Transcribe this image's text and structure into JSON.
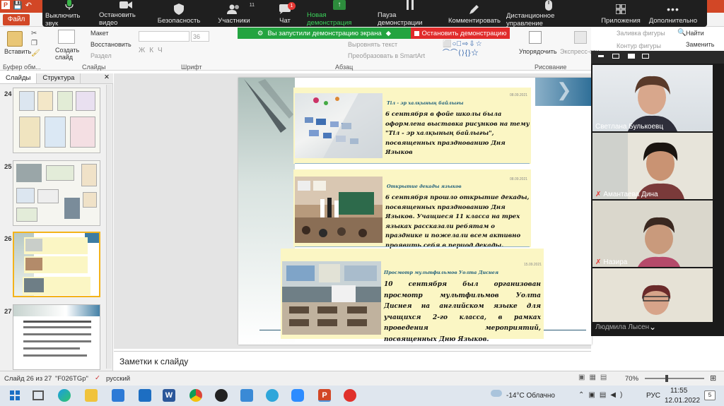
{
  "window": {
    "file_tab": "Файл"
  },
  "zoom_toolbar": {
    "items": [
      {
        "label": "Выключить звук",
        "icon": "microphone-icon"
      },
      {
        "label": "Остановить видео",
        "icon": "camera-icon"
      },
      {
        "label": "Безопасность",
        "icon": "shield-icon"
      },
      {
        "label": "Участники",
        "icon": "participants-icon",
        "count": "11"
      },
      {
        "label": "Чат",
        "icon": "chat-icon",
        "badge": "1"
      },
      {
        "label": "Новая демонстрация",
        "icon": "share-screen-icon"
      },
      {
        "label": "Пауза демонстрации",
        "icon": "pause-icon"
      },
      {
        "label": "Комментировать",
        "icon": "pen-icon"
      },
      {
        "label": "Дистанционное управление",
        "icon": "mouse-icon"
      },
      {
        "label": "Приложения",
        "icon": "apps-icon"
      },
      {
        "label": "Дополнительно",
        "icon": "more-icon"
      }
    ],
    "sharing_banner": "Вы запустили демонстрацию экрана",
    "stop_button": "Остановить демонстрацию"
  },
  "ribbon": {
    "paste": "Вставить",
    "create_slide": "Создать слайд",
    "layout": "Макет",
    "restore": "Восстановить",
    "section": "Раздел",
    "font_size": "36",
    "align_text": "Выровнять текст",
    "smartart": "Преобразовать в SmartArt",
    "arrange": "Упорядочить",
    "express_styles": "Экспресс-сти",
    "shape_fill": "Заливка фигуры",
    "shape_outline": "Контур фигуры",
    "find": "Найти",
    "replace": "Заменить",
    "groups": {
      "clipboard": "Буфер обм...",
      "slides": "Слайды",
      "font": "Шрифт",
      "paragraph": "Абзац",
      "drawing": "Рисование"
    }
  },
  "slides_panel": {
    "tabs": [
      "Слайды",
      "Структура"
    ],
    "thumbnails": [
      "24",
      "25",
      "26",
      "27"
    ]
  },
  "slide": {
    "cards": [
      {
        "date": "08.09.2021",
        "title": "Тіл - эр халқының байлығы",
        "text": "6 сентября в фойе школы была оформлена выставка рисунков на тему \"Тіл - эр халқының байлығы\", посвященных празднованию Дня Языков"
      },
      {
        "date": "08.09.2021",
        "title": "Открытие декады языков",
        "text": "6 сентября прошло открытие декады, посвященных празднованию Дня Языков. Учащиеся 11 класса на трех языках рассказали ребятам о празднике и пожелали всем активно проявить себя в период декады."
      },
      {
        "date": "15.09.2021",
        "title": "Просмотр мультфильмов Уолта Диснея",
        "text": "10 сентября был организован просмотр мультфильмов Уолта Диснея на английском языке для учащихся 2-го класса, в рамках проведения мероприятий, посвященных Дню Языков."
      }
    ]
  },
  "notes": {
    "placeholder": "Заметки к слайду"
  },
  "status_bar": {
    "slide_info": "Слайд 26 из 27",
    "theme": "\"F026TGp\"",
    "language": "русский",
    "zoom": "70%"
  },
  "video_panel": {
    "participants": [
      {
        "name": "Светлана Булькоевц",
        "muted": false
      },
      {
        "name": "Амантаева Дина",
        "muted": true
      },
      {
        "name": "Назира",
        "muted": true
      },
      {
        "name": "Людмила Лысен",
        "muted": false
      }
    ]
  },
  "taskbar": {
    "weather": "-14°C Облачно",
    "language": "РУС",
    "time": "11:55",
    "date": "12.01.2022",
    "notifications": "5"
  }
}
